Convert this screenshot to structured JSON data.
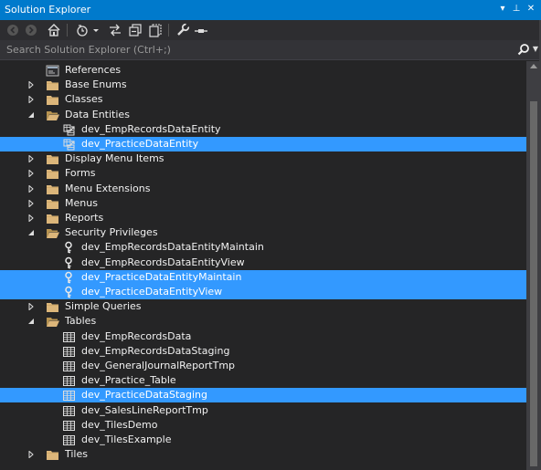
{
  "window": {
    "title": "Solution Explorer",
    "buttons": [
      "▾",
      "⊥",
      "✕"
    ]
  },
  "search": {
    "placeholder": "Search Solution Explorer (Ctrl+;)"
  },
  "colors": {
    "accent": "#007acc",
    "selection": "#3399ff",
    "folder": "#dcb67a",
    "background": "#252526"
  },
  "tree": [
    {
      "label": "References",
      "depth": 1,
      "expander": "none",
      "icon": "references-icon",
      "selected": false
    },
    {
      "label": "Base Enums",
      "depth": 1,
      "expander": "collapsed",
      "icon": "folder-icon",
      "selected": false
    },
    {
      "label": "Classes",
      "depth": 1,
      "expander": "collapsed",
      "icon": "folder-icon",
      "selected": false
    },
    {
      "label": "Data Entities",
      "depth": 1,
      "expander": "expanded",
      "icon": "folder-open-icon",
      "selected": false
    },
    {
      "label": "dev_EmpRecordsDataEntity",
      "depth": 2,
      "expander": "none",
      "icon": "data-entity-icon",
      "selected": false
    },
    {
      "label": "dev_PracticeDataEntity",
      "depth": 2,
      "expander": "none",
      "icon": "data-entity-icon",
      "selected": true
    },
    {
      "label": "Display Menu Items",
      "depth": 1,
      "expander": "collapsed",
      "icon": "folder-icon",
      "selected": false
    },
    {
      "label": "Forms",
      "depth": 1,
      "expander": "collapsed",
      "icon": "folder-icon",
      "selected": false
    },
    {
      "label": "Menu Extensions",
      "depth": 1,
      "expander": "collapsed",
      "icon": "folder-icon",
      "selected": false
    },
    {
      "label": "Menus",
      "depth": 1,
      "expander": "collapsed",
      "icon": "folder-icon",
      "selected": false
    },
    {
      "label": "Reports",
      "depth": 1,
      "expander": "collapsed",
      "icon": "folder-icon",
      "selected": false
    },
    {
      "label": "Security Privileges",
      "depth": 1,
      "expander": "expanded",
      "icon": "folder-open-icon",
      "selected": false
    },
    {
      "label": "dev_EmpRecordsDataEntityMaintain",
      "depth": 2,
      "expander": "none",
      "icon": "key-icon",
      "selected": false
    },
    {
      "label": "dev_EmpRecordsDataEntityView",
      "depth": 2,
      "expander": "none",
      "icon": "key-icon",
      "selected": false
    },
    {
      "label": "dev_PracticeDataEntityMaintain",
      "depth": 2,
      "expander": "none",
      "icon": "key-icon",
      "selected": true
    },
    {
      "label": "dev_PracticeDataEntityView",
      "depth": 2,
      "expander": "none",
      "icon": "key-icon",
      "selected": true
    },
    {
      "label": "Simple Queries",
      "depth": 1,
      "expander": "collapsed",
      "icon": "folder-icon",
      "selected": false
    },
    {
      "label": "Tables",
      "depth": 1,
      "expander": "expanded",
      "icon": "folder-open-icon",
      "selected": false
    },
    {
      "label": "dev_EmpRecordsData",
      "depth": 2,
      "expander": "none",
      "icon": "table-icon",
      "selected": false
    },
    {
      "label": "dev_EmpRecordsDataStaging",
      "depth": 2,
      "expander": "none",
      "icon": "table-icon",
      "selected": false
    },
    {
      "label": "dev_GeneralJournalReportTmp",
      "depth": 2,
      "expander": "none",
      "icon": "table-icon",
      "selected": false
    },
    {
      "label": "dev_Practice_Table",
      "depth": 2,
      "expander": "none",
      "icon": "table-icon",
      "selected": false
    },
    {
      "label": "dev_PracticeDataStaging",
      "depth": 2,
      "expander": "none",
      "icon": "table-icon",
      "selected": true
    },
    {
      "label": "dev_SalesLineReportTmp",
      "depth": 2,
      "expander": "none",
      "icon": "table-icon",
      "selected": false
    },
    {
      "label": "dev_TilesDemo",
      "depth": 2,
      "expander": "none",
      "icon": "table-icon",
      "selected": false
    },
    {
      "label": "dev_TilesExample",
      "depth": 2,
      "expander": "none",
      "icon": "table-icon",
      "selected": false
    },
    {
      "label": "Tiles",
      "depth": 1,
      "expander": "collapsed",
      "icon": "folder-icon",
      "selected": false
    }
  ]
}
